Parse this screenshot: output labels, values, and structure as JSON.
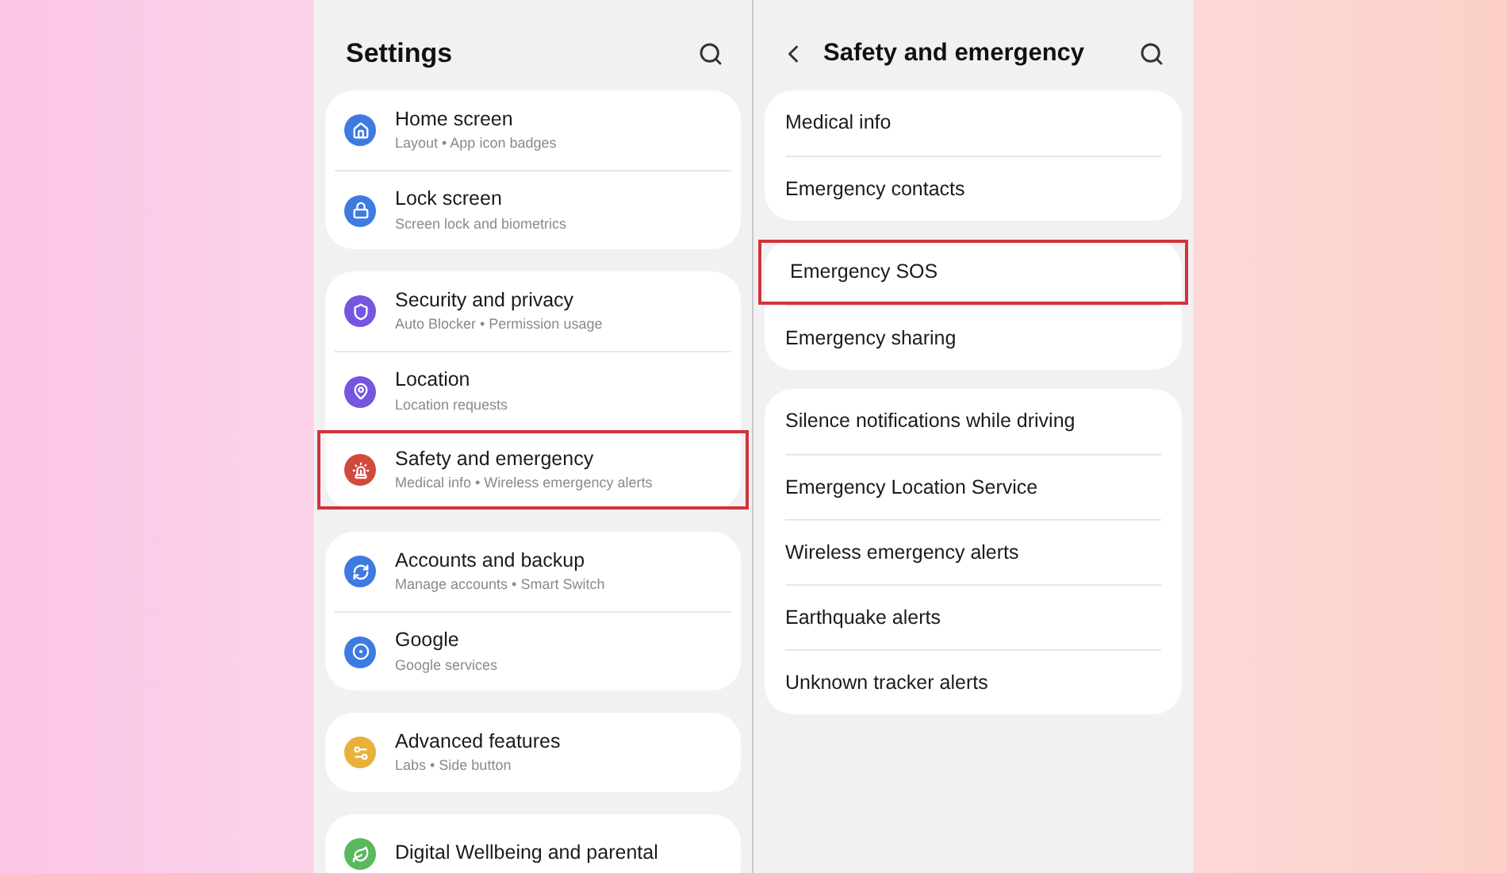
{
  "settings_screen": {
    "title": "Settings",
    "groups": [
      {
        "items": [
          {
            "title": "Home screen",
            "subtitle": "Layout • App icon badges",
            "color": "#3d7be0",
            "highlighted": false
          },
          {
            "title": "Lock screen",
            "subtitle": "Screen lock and biometrics",
            "color": "#3d7be0",
            "highlighted": false
          }
        ]
      },
      {
        "items": [
          {
            "title": "Security and privacy",
            "subtitle": "Auto Blocker • Permission usage",
            "color": "#7556e0",
            "highlighted": false
          },
          {
            "title": "Location",
            "subtitle": "Location requests",
            "color": "#7556e0",
            "highlighted": false
          },
          {
            "title": "Safety and emergency",
            "subtitle": "Medical info • Wireless emergency alerts",
            "color": "#d14a3e",
            "highlighted": true
          }
        ]
      },
      {
        "items": [
          {
            "title": "Accounts and backup",
            "subtitle": "Manage accounts • Smart Switch",
            "color": "#3d7be0",
            "highlighted": false
          },
          {
            "title": "Google",
            "subtitle": "Google services",
            "color": "#3d7be0",
            "highlighted": false
          }
        ]
      },
      {
        "items": [
          {
            "title": "Advanced features",
            "subtitle": "Labs • Side button",
            "color": "#e8b23a",
            "highlighted": false
          }
        ]
      },
      {
        "items": [
          {
            "title": "Digital Wellbeing and parental",
            "color": "#5cb85c",
            "highlighted": false
          }
        ]
      }
    ]
  },
  "safety_screen": {
    "title": "Safety and emergency",
    "groups": [
      {
        "items": [
          {
            "title": "Medical info",
            "highlighted": false
          },
          {
            "title": "Emergency contacts",
            "highlighted": false
          }
        ]
      },
      {
        "items": [
          {
            "title": "Emergency SOS",
            "highlighted": true
          },
          {
            "title": "Emergency sharing",
            "highlighted": false
          }
        ]
      },
      {
        "items": [
          {
            "title": "Silence notifications while driving",
            "highlighted": false
          },
          {
            "title": "Emergency Location Service",
            "highlighted": false
          },
          {
            "title": "Wireless emergency alerts",
            "highlighted": false
          },
          {
            "title": "Earthquake alerts",
            "highlighted": false
          },
          {
            "title": "Unknown tracker alerts",
            "highlighted": false
          }
        ]
      }
    ]
  }
}
